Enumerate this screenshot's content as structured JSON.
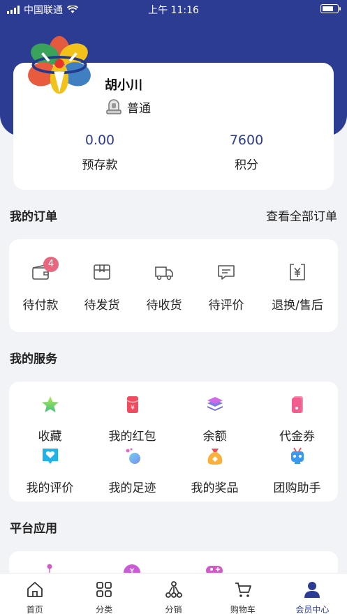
{
  "status_bar": {
    "carrier": "中国联通",
    "time": "上午 11:16",
    "battery_level": 0.8
  },
  "profile": {
    "name": "胡小川",
    "level": "普通"
  },
  "stats": [
    {
      "value": "0.00",
      "label": "预存款"
    },
    {
      "value": "7600",
      "label": "积分"
    }
  ],
  "orders": {
    "title": "我的订单",
    "view_all": "查看全部订单",
    "items": [
      {
        "label": "待付款",
        "icon": "wallet-icon",
        "badge": "4"
      },
      {
        "label": "待发货",
        "icon": "box-icon"
      },
      {
        "label": "待收货",
        "icon": "truck-icon"
      },
      {
        "label": "待评价",
        "icon": "comment-icon"
      },
      {
        "label": "退换/售后",
        "icon": "yen-return-icon"
      }
    ]
  },
  "services": {
    "title": "我的服务",
    "items": [
      {
        "label": "收藏",
        "icon": "star-icon"
      },
      {
        "label": "我的红包",
        "icon": "red-packet-icon"
      },
      {
        "label": "余额",
        "icon": "layers-icon"
      },
      {
        "label": "代金券",
        "icon": "voucher-icon"
      },
      {
        "label": "我的评价",
        "icon": "heart-bubble-icon"
      },
      {
        "label": "我的足迹",
        "icon": "footprint-icon"
      },
      {
        "label": "我的奖品",
        "icon": "prize-bag-icon"
      },
      {
        "label": "团购助手",
        "icon": "robot-icon"
      }
    ]
  },
  "platform": {
    "title": "平台应用"
  },
  "tabbar": {
    "items": [
      {
        "label": "首页",
        "icon": "home-icon"
      },
      {
        "label": "分类",
        "icon": "grid-icon"
      },
      {
        "label": "分销",
        "icon": "share-network-icon"
      },
      {
        "label": "购物车",
        "icon": "cart-icon"
      },
      {
        "label": "会员中心",
        "icon": "user-icon",
        "active": true
      }
    ]
  },
  "colors": {
    "brand": "#2d3c93",
    "badge": "#e8677f",
    "background": "#f2f3f6"
  }
}
